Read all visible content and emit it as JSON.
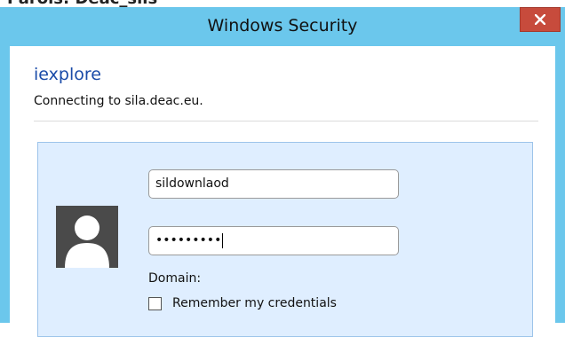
{
  "window": {
    "title": "Windows Security",
    "top_fragment": "Parols: Deac_sils"
  },
  "dialog": {
    "app_name": "iexplore",
    "connect_text": "Connecting to sila.deac.eu."
  },
  "credentials": {
    "username_value": "sildownlaod",
    "password_masked": "•••••••••",
    "domain_label": "Domain:",
    "remember_label": "Remember my credentials",
    "remember_checked": false
  },
  "icons": {
    "close": "close-icon",
    "avatar": "user-avatar-icon"
  },
  "colors": {
    "titlebar": "#6bc7ec",
    "close_button": "#c74b3c",
    "app_name": "#1a4ba8",
    "panel": "#dfeeff"
  }
}
